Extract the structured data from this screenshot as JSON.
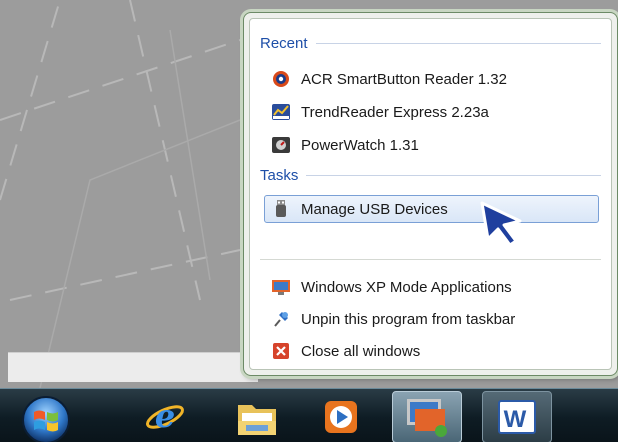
{
  "jumplist": {
    "recent_header": "Recent",
    "tasks_header": "Tasks",
    "recent_items": [
      {
        "label": "ACR SmartButton Reader 1.32",
        "icon": "acr-smartbutton-icon"
      },
      {
        "label": "TrendReader Express 2.23a",
        "icon": "trendreader-icon"
      },
      {
        "label": "PowerWatch 1.31",
        "icon": "powerwatch-icon"
      }
    ],
    "tasks": [
      {
        "label": "Manage USB Devices",
        "icon": "usb-icon",
        "highlighted": true
      }
    ],
    "actions": [
      {
        "label": "Windows XP Mode Applications",
        "icon": "xp-mode-icon"
      },
      {
        "label": "Unpin this program from taskbar",
        "icon": "unpin-icon"
      },
      {
        "label": "Close all windows",
        "icon": "close-windows-icon"
      }
    ]
  },
  "taskbar": {
    "buttons": [
      {
        "name": "internet-explorer",
        "icon": "internet-explorer-icon"
      },
      {
        "name": "windows-explorer",
        "icon": "folder-icon"
      },
      {
        "name": "media-player",
        "icon": "media-player-icon"
      },
      {
        "name": "xp-mode",
        "icon": "xp-mode-icon",
        "active": true
      },
      {
        "name": "word",
        "icon": "word-icon",
        "label": "W"
      }
    ]
  },
  "colors": {
    "header": "#1e4fa8",
    "highlight_border": "#7aa0d6",
    "taskbar": "#0e1c24",
    "desktop": "#9c9c9c"
  }
}
